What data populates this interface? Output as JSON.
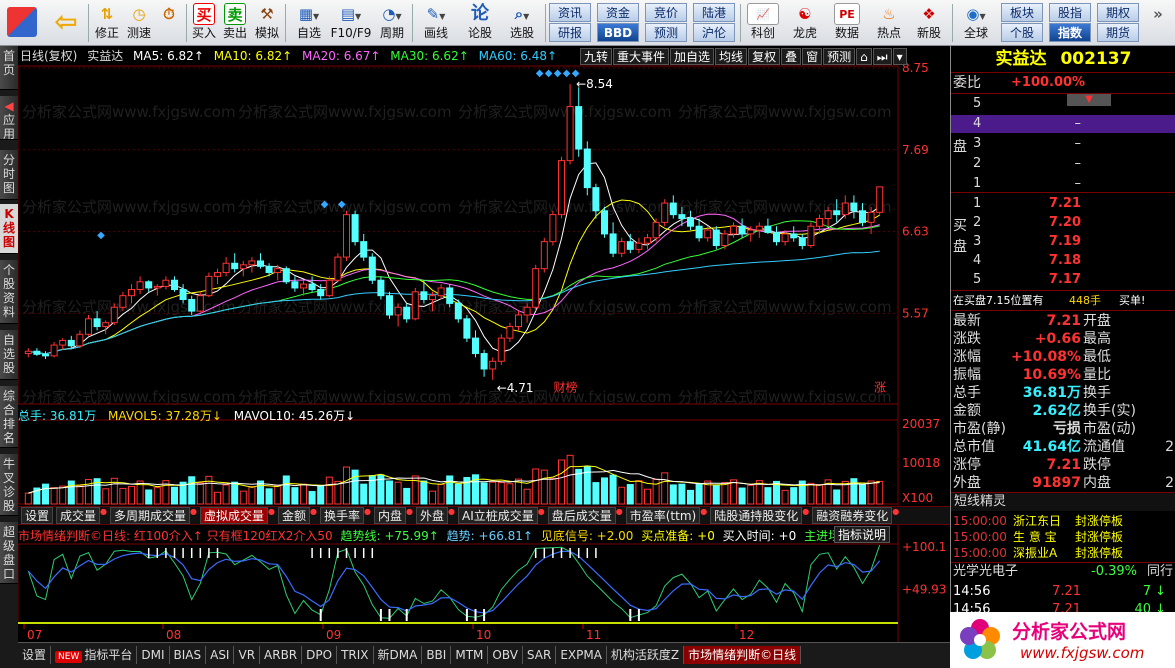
{
  "toolbar": {
    "items": [
      {
        "name": "home",
        "label": "",
        "icon": "grid-icon"
      },
      {
        "name": "back",
        "label": "",
        "icon": "back-arrow-icon"
      },
      {
        "name": "modify",
        "label": "修正",
        "icon": "arrows-updown-icon"
      },
      {
        "name": "test",
        "label": "测速",
        "icon": "clock-icon"
      },
      {
        "name": "buy",
        "label": "买入",
        "icon": "buy-icon",
        "glyph": "买"
      },
      {
        "name": "sell",
        "label": "卖出",
        "icon": "sell-icon",
        "glyph": "卖"
      },
      {
        "name": "simulate",
        "label": "模拟",
        "icon": "hammer-icon"
      },
      {
        "name": "watchlist",
        "label": "自选",
        "icon": "watchlist-icon"
      },
      {
        "name": "f10",
        "label": "F10/F9",
        "icon": "f10-icon"
      },
      {
        "name": "period",
        "label": "周期",
        "icon": "period-icon"
      },
      {
        "name": "draw",
        "label": "画线",
        "icon": "pen-icon"
      },
      {
        "name": "review",
        "label": "论股",
        "icon": "discuss-icon",
        "glyph": "论"
      },
      {
        "name": "select",
        "label": "选股",
        "icon": "magnifier-chart-icon"
      }
    ],
    "blue_buttons": [
      [
        "资讯",
        "资金",
        "竞价",
        "陆港"
      ],
      [
        "研报",
        "BBD",
        "预测",
        "沪伦"
      ]
    ],
    "right_items": [
      {
        "name": "kechuang",
        "label": "科创",
        "icon": "kechuang-icon"
      },
      {
        "name": "longhu",
        "label": "龙虎",
        "icon": "dragon-icon"
      },
      {
        "name": "data",
        "label": "数据",
        "icon": "pe-icon",
        "glyph": "PE"
      },
      {
        "name": "hot",
        "label": "热点",
        "icon": "fire-icon"
      },
      {
        "name": "newstock",
        "label": "新股",
        "icon": "newstock-icon"
      },
      {
        "name": "global",
        "label": "全球",
        "icon": "globe-icon"
      }
    ],
    "right_buttons": [
      [
        "板块",
        "股指",
        "期权"
      ],
      [
        "个股",
        "指数",
        "期货"
      ]
    ],
    "colors": {
      "accent": "#c8102e",
      "blue_btn": "#2a5ea8"
    }
  },
  "left_tabs": [
    {
      "label": "首页",
      "active": false
    },
    {
      "label": "应用",
      "active": false
    },
    {
      "label": "分时图",
      "active": false
    },
    {
      "label": "K线图",
      "active": true
    },
    {
      "label": "个股资料",
      "active": false
    },
    {
      "label": "自选股",
      "active": false
    },
    {
      "label": "综合排名",
      "active": false
    },
    {
      "label": "牛叉诊股",
      "active": false
    },
    {
      "label": "超级盘口",
      "active": false
    }
  ],
  "chart_header": {
    "period": "日线(复权)",
    "stock": "实益达",
    "ma5_label": "MA5: 6.82↑",
    "ma10_label": "MA10: 6.82↑",
    "ma20_label": "MA20: 6.67↑",
    "ma30_label": "MA30: 6.62↑",
    "ma60_label": "MA60: 6.48↑",
    "buttons": [
      "九转",
      "重大事件",
      "加自选",
      "均线",
      "复权",
      "叠",
      "窗",
      "预测"
    ]
  },
  "watermark": "分析家公式网www.fxjgsw.com",
  "chart_data": {
    "type": "candlestick",
    "ylim": [
      4.5,
      8.75
    ],
    "ticks": [
      "8.75",
      "7.69",
      "6.63",
      "5.57"
    ],
    "annotations": {
      "high": "8.54",
      "low": "4.71",
      "caibang": "财榜",
      "zhang": "涨"
    },
    "x_labels": [
      "07",
      "08",
      "09",
      "10",
      "11",
      "12"
    ],
    "candles": [
      [
        5.05,
        5.12,
        5.0,
        5.08
      ],
      [
        5.08,
        5.12,
        5.02,
        5.04
      ],
      [
        5.04,
        5.08,
        4.98,
        5.02
      ],
      [
        5.02,
        5.2,
        5.0,
        5.16
      ],
      [
        5.16,
        5.25,
        5.1,
        5.22
      ],
      [
        5.22,
        5.28,
        5.12,
        5.15
      ],
      [
        5.15,
        5.35,
        5.12,
        5.3
      ],
      [
        5.3,
        5.55,
        5.28,
        5.5
      ],
      [
        5.5,
        5.6,
        5.35,
        5.4
      ],
      [
        5.4,
        5.48,
        5.3,
        5.45
      ],
      [
        5.45,
        5.7,
        5.42,
        5.65
      ],
      [
        5.65,
        5.85,
        5.6,
        5.8
      ],
      [
        5.8,
        5.95,
        5.7,
        5.88
      ],
      [
        5.88,
        6.05,
        5.82,
        5.98
      ],
      [
        5.98,
        6.0,
        5.85,
        5.9
      ],
      [
        5.9,
        5.95,
        5.8,
        5.92
      ],
      [
        5.92,
        6.05,
        5.88,
        6.0
      ],
      [
        6.0,
        6.05,
        5.85,
        5.88
      ],
      [
        5.88,
        5.95,
        5.7,
        5.75
      ],
      [
        5.75,
        5.8,
        5.55,
        5.6
      ],
      [
        5.6,
        5.85,
        5.58,
        5.8
      ],
      [
        5.8,
        6.1,
        5.78,
        6.05
      ],
      [
        6.05,
        6.15,
        5.95,
        6.1
      ],
      [
        6.1,
        6.3,
        6.05,
        6.22
      ],
      [
        6.22,
        6.35,
        6.1,
        6.15
      ],
      [
        6.15,
        6.25,
        6.05,
        6.2
      ],
      [
        6.2,
        6.3,
        6.1,
        6.25
      ],
      [
        6.25,
        6.35,
        6.15,
        6.18
      ],
      [
        6.18,
        6.22,
        6.05,
        6.1
      ],
      [
        6.1,
        6.2,
        6.0,
        6.15
      ],
      [
        6.15,
        6.18,
        5.95,
        5.98
      ],
      [
        5.98,
        6.05,
        5.85,
        5.9
      ],
      [
        5.9,
        6.0,
        5.8,
        5.95
      ],
      [
        5.95,
        6.05,
        5.85,
        5.88
      ],
      [
        5.88,
        5.95,
        5.75,
        5.8
      ],
      [
        5.8,
        6.05,
        5.78,
        6.0
      ],
      [
        6.0,
        6.35,
        5.98,
        6.3
      ],
      [
        6.3,
        6.9,
        6.25,
        6.85
      ],
      [
        6.85,
        6.9,
        6.45,
        6.5
      ],
      [
        6.5,
        6.6,
        6.25,
        6.3
      ],
      [
        6.3,
        6.35,
        5.95,
        6.0
      ],
      [
        6.0,
        6.05,
        5.75,
        5.8
      ],
      [
        5.8,
        5.85,
        5.5,
        5.55
      ],
      [
        5.55,
        5.7,
        5.4,
        5.65
      ],
      [
        5.65,
        5.7,
        5.45,
        5.5
      ],
      [
        5.5,
        5.9,
        5.48,
        5.85
      ],
      [
        5.85,
        6.0,
        5.7,
        5.75
      ],
      [
        5.75,
        5.85,
        5.6,
        5.8
      ],
      [
        5.8,
        5.95,
        5.75,
        5.9
      ],
      [
        5.9,
        5.95,
        5.65,
        5.7
      ],
      [
        5.7,
        5.75,
        5.45,
        5.5
      ],
      [
        5.5,
        5.55,
        5.2,
        5.25
      ],
      [
        5.25,
        5.35,
        5.0,
        5.05
      ],
      [
        5.05,
        5.1,
        4.75,
        4.85
      ],
      [
        4.85,
        5.0,
        4.71,
        4.95
      ],
      [
        4.95,
        5.3,
        4.9,
        5.25
      ],
      [
        5.25,
        5.45,
        5.2,
        5.4
      ],
      [
        5.4,
        5.6,
        5.35,
        5.55
      ],
      [
        5.55,
        5.7,
        5.45,
        5.65
      ],
      [
        5.65,
        6.2,
        5.6,
        6.15
      ],
      [
        6.15,
        6.55,
        6.1,
        6.5
      ],
      [
        6.5,
        6.9,
        6.45,
        6.85
      ],
      [
        6.85,
        7.6,
        6.8,
        7.55
      ],
      [
        7.55,
        8.54,
        7.5,
        8.25
      ],
      [
        8.25,
        8.5,
        7.6,
        7.7
      ],
      [
        7.7,
        7.8,
        7.1,
        7.2
      ],
      [
        7.2,
        7.25,
        6.8,
        6.9
      ],
      [
        6.9,
        6.95,
        6.55,
        6.6
      ],
      [
        6.6,
        6.75,
        6.3,
        6.35
      ],
      [
        6.35,
        6.55,
        6.3,
        6.5
      ],
      [
        6.5,
        6.6,
        6.35,
        6.4
      ],
      [
        6.4,
        6.55,
        6.35,
        6.48
      ],
      [
        6.48,
        6.6,
        6.4,
        6.55
      ],
      [
        6.55,
        6.8,
        6.5,
        6.75
      ],
      [
        6.75,
        7.05,
        6.7,
        7.0
      ],
      [
        7.0,
        7.1,
        6.8,
        6.85
      ],
      [
        6.85,
        6.95,
        6.7,
        6.8
      ],
      [
        6.8,
        6.9,
        6.65,
        6.7
      ],
      [
        6.7,
        6.8,
        6.5,
        6.55
      ],
      [
        6.55,
        6.7,
        6.5,
        6.65
      ],
      [
        6.65,
        6.7,
        6.4,
        6.45
      ],
      [
        6.45,
        6.65,
        6.4,
        6.6
      ],
      [
        6.6,
        6.75,
        6.55,
        6.7
      ],
      [
        6.7,
        6.8,
        6.55,
        6.6
      ],
      [
        6.6,
        6.7,
        6.5,
        6.65
      ],
      [
        6.65,
        6.75,
        6.55,
        6.7
      ],
      [
        6.7,
        6.8,
        6.6,
        6.62
      ],
      [
        6.62,
        6.7,
        6.45,
        6.5
      ],
      [
        6.5,
        6.65,
        6.45,
        6.6
      ],
      [
        6.6,
        6.7,
        6.5,
        6.55
      ],
      [
        6.55,
        6.6,
        6.4,
        6.45
      ],
      [
        6.45,
        6.75,
        6.42,
        6.7
      ],
      [
        6.7,
        6.85,
        6.6,
        6.8
      ],
      [
        6.8,
        6.95,
        6.7,
        6.9
      ],
      [
        6.9,
        7.05,
        6.75,
        6.85
      ],
      [
        6.85,
        7.1,
        6.8,
        7.0
      ],
      [
        7.0,
        7.1,
        6.8,
        6.9
      ],
      [
        6.9,
        7.0,
        6.7,
        6.75
      ],
      [
        6.75,
        6.95,
        6.6,
        6.88
      ],
      [
        6.88,
        7.2,
        6.85,
        7.21
      ]
    ],
    "ma_colors": {
      "ma5": "#ffffff",
      "ma10": "#ffff00",
      "ma20": "#ff66ff",
      "ma30": "#33ff33",
      "ma60": "#33ccff"
    },
    "up_color": "#ff3232",
    "down_color": "#54ffff"
  },
  "volume": {
    "header_total": "总手: 36.81万",
    "mavol5": "MAVOL5: 37.28万↓",
    "mavol10": "MAVOL10: 45.26万↓",
    "ticks": [
      "20037",
      "10018",
      "X100"
    ]
  },
  "vol_tabs": [
    "设置",
    "成交量",
    "多周期成交量",
    "虚拟成交量",
    "金额",
    "换手率",
    "内盘",
    "外盘",
    "AI立桩成交量",
    "盘后成交量",
    "市盈率(ttm)",
    "陆股通持股变化",
    "融资融券变化"
  ],
  "vol_active": "虚拟成交量",
  "indicator": {
    "title": "市场情绪判断©日线: 红100介入↑ 只有框120红X2介入50",
    "trend": "趋势线: +75.99↑",
    "trend2": "趋势: +66.81↑",
    "signal": "见底信号: +2.00",
    "buy_ready": "买点准备: +0",
    "buy_time": "买入时间: +0",
    "main_in": "主进场: +0",
    "help": "指标说明",
    "ticks": [
      "+100.1",
      "+49.93"
    ]
  },
  "bottom_tabs": [
    "设置",
    "指标平台",
    "DMI",
    "BIAS",
    "ASI",
    "VR",
    "ARBR",
    "DPO",
    "TRIX",
    "新DMA",
    "BBI",
    "MTM",
    "OBV",
    "SAR",
    "EXPMA",
    "机构活跃度Z",
    "市场情绪判断©日线"
  ],
  "bottom_new_label": "NEW",
  "right_panel": {
    "name": "实益达",
    "code": "002137",
    "weibi_label": "委比",
    "weibi": "+100.00%",
    "sell_label": "卖盘",
    "buy_label": "买盘",
    "sells": [
      [
        "5",
        ""
      ],
      [
        "4",
        "–"
      ],
      [
        "3",
        "–"
      ],
      [
        "2",
        "–"
      ],
      [
        "1",
        "–"
      ]
    ],
    "buys": [
      [
        "1",
        "7.21"
      ],
      [
        "2",
        "7.20"
      ],
      [
        "3",
        "7.19"
      ],
      [
        "4",
        "7.18"
      ],
      [
        "5",
        "7.17"
      ]
    ],
    "inbuy": "在买盘7.15位置有",
    "inbuy_num": "448手",
    "inbuy_tag": "买单!",
    "quotes": [
      [
        "最新",
        "7.21",
        "开盘",
        ""
      ],
      [
        "涨跌",
        "+0.66",
        "最高",
        ""
      ],
      [
        "涨幅",
        "+10.08%",
        "最低",
        ""
      ],
      [
        "振幅",
        "10.69%",
        "量比",
        ""
      ],
      [
        "总手",
        "36.81万",
        "换手",
        ""
      ],
      [
        "金额",
        "2.62亿",
        "换手(实)",
        ""
      ],
      [
        "市盈(静)",
        "亏损",
        "市盈(动)",
        ""
      ],
      [
        "总市值",
        "41.64亿",
        "流通值",
        "2"
      ],
      [
        "涨停",
        "7.21",
        "跌停",
        ""
      ],
      [
        "外盘",
        "91897",
        "内盘",
        "2"
      ]
    ],
    "short_title": "短线精灵",
    "short_list": [
      [
        "15:00:00",
        "浙江东日",
        "封涨停板"
      ],
      [
        "15:00:00",
        "生 意 宝",
        "封涨停板"
      ],
      [
        "15:00:00",
        "深振业A",
        "封涨停板"
      ]
    ],
    "sector": "光学光电子",
    "sector_change": "-0.39%",
    "sector_tag": "同行",
    "ticks": [
      [
        "14:56",
        "7.21",
        "7"
      ],
      [
        "14:56",
        "7.21",
        "40"
      ]
    ],
    "logo_text": "分析家公式网",
    "logo_url": "www.fxjgsw.com"
  }
}
